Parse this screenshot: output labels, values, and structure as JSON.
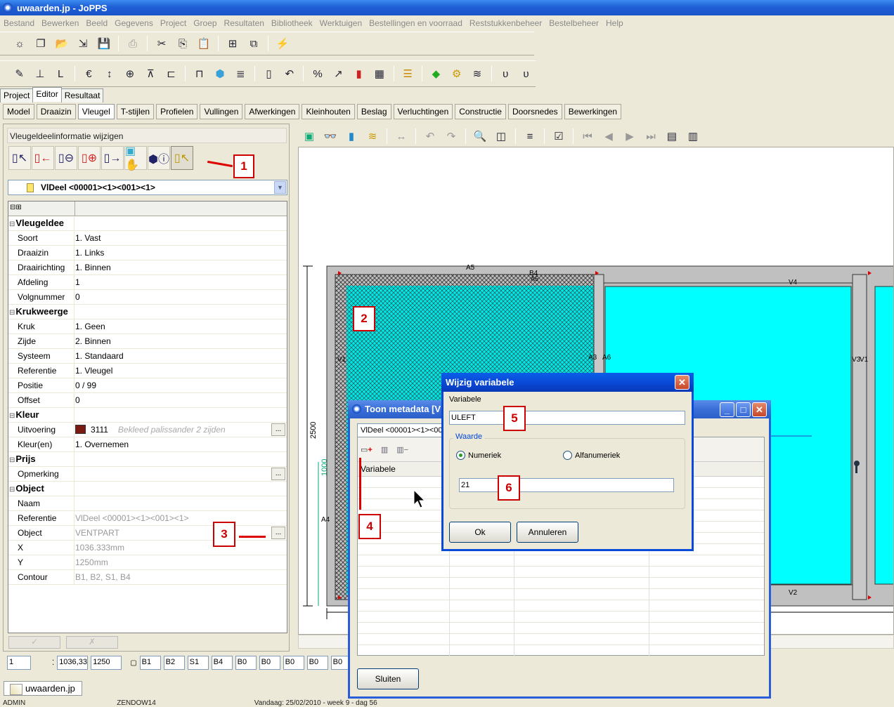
{
  "window": {
    "title": "uwaarden.jp - JoPPS"
  },
  "menu": [
    "Bestand",
    "Bewerken",
    "Beeld",
    "Gegevens",
    "Project",
    "Groep",
    "Resultaten",
    "Bibliotheek",
    "Werktuigen",
    "Bestellingen en voorraad",
    "Reststukkenbeheer",
    "Bestelbeheer",
    "Help"
  ],
  "tabs_top": [
    "Project",
    "Editor",
    "Resultaat"
  ],
  "tabs_editor": [
    "Model",
    "Draaizin",
    "Vleugel",
    "T-stijlen",
    "Profielen",
    "Vullingen",
    "Afwerkingen",
    "Kleinhouten",
    "Beslag",
    "Verluchtingen",
    "Constructie",
    "Doorsnedes",
    "Bewerkingen"
  ],
  "panel": {
    "header": "Vleugeldeelinformatie wijzigen",
    "combo": "VlDeel <00001><1><001><1>",
    "groups": {
      "vleugel": "Vleugeldee",
      "kruk": "Krukweerge",
      "kleur": "Kleur",
      "prijs": "Prijs",
      "object": "Object"
    },
    "props": {
      "soort": {
        "k": "Soort",
        "v": "1. Vast"
      },
      "draaizin": {
        "k": "Draaizin",
        "v": "1. Links"
      },
      "draairichting": {
        "k": "Draairichting",
        "v": "1. Binnen"
      },
      "afdeling": {
        "k": "Afdeling",
        "v": "1"
      },
      "volgnummer": {
        "k": "Volgnummer",
        "v": "0"
      },
      "kruk": {
        "k": "Kruk",
        "v": "1. Geen"
      },
      "zijde": {
        "k": "Zijde",
        "v": "2. Binnen"
      },
      "systeem": {
        "k": "Systeem",
        "v": "1. Standaard"
      },
      "referentie1": {
        "k": "Referentie",
        "v": "1. Vleugel"
      },
      "positie": {
        "k": "Positie",
        "v": "0 / 99"
      },
      "offset": {
        "k": "Offset",
        "v": "0"
      },
      "uitvoering": {
        "k": "Uitvoering",
        "v": "3111",
        "hint": "Bekleed palissander 2 zijden"
      },
      "kleuren": {
        "k": "Kleur(en)",
        "v": "1. Overnemen"
      },
      "opmerking": {
        "k": "Opmerking",
        "v": ""
      },
      "naam": {
        "k": "Naam",
        "v": ""
      },
      "referentie2": {
        "k": "Referentie",
        "v": "VlDeel <00001><1><001><1>"
      },
      "object": {
        "k": "Object",
        "v": "VENTPART"
      },
      "x": {
        "k": "X",
        "v": "1036.333mm"
      },
      "y": {
        "k": "Y",
        "v": "1250mm"
      },
      "contour": {
        "k": "Contour",
        "v": "B1, B2, S1, B4"
      }
    },
    "ok": "✓",
    "cancel": "✗"
  },
  "statusfields": [
    "1",
    "1036,33:",
    "1250",
    "B1",
    "B2",
    "S1",
    "B4",
    "B0",
    "B0",
    "B0",
    "B0",
    "B0"
  ],
  "doctab": "uwaarden.jp",
  "statusbar": [
    "ADMIN",
    "ZENDOW14",
    "Vandaag: 25/02/2010 - week 9 - dag 56"
  ],
  "drawing": {
    "labels": [
      "A5",
      "B4",
      "V4",
      "V1",
      "A3",
      "A6",
      "V3",
      "V1",
      "A4",
      "V2",
      "A5",
      "2500",
      "1000"
    ]
  },
  "metadata_window": {
    "title": "Toon metadata [V",
    "combo": "VlDeel <00001><1><001",
    "column": "Variabele",
    "close": "Sluiten"
  },
  "dialog": {
    "title": "Wijzig variabele",
    "var_label": "Variabele",
    "var_value": "ULEFT",
    "group": "Waarde",
    "radio_num": "Numeriek",
    "radio_alpha": "Alfanumeriek",
    "value": "21",
    "ok": "Ok",
    "cancel": "Annuleren"
  },
  "markers": [
    "1",
    "2",
    "3",
    "4",
    "5",
    "6"
  ],
  "colors": {
    "glass": "#00ffff",
    "frame": "#c0c0c0",
    "marker": "#cc0000",
    "title": "#0a4ad8"
  }
}
